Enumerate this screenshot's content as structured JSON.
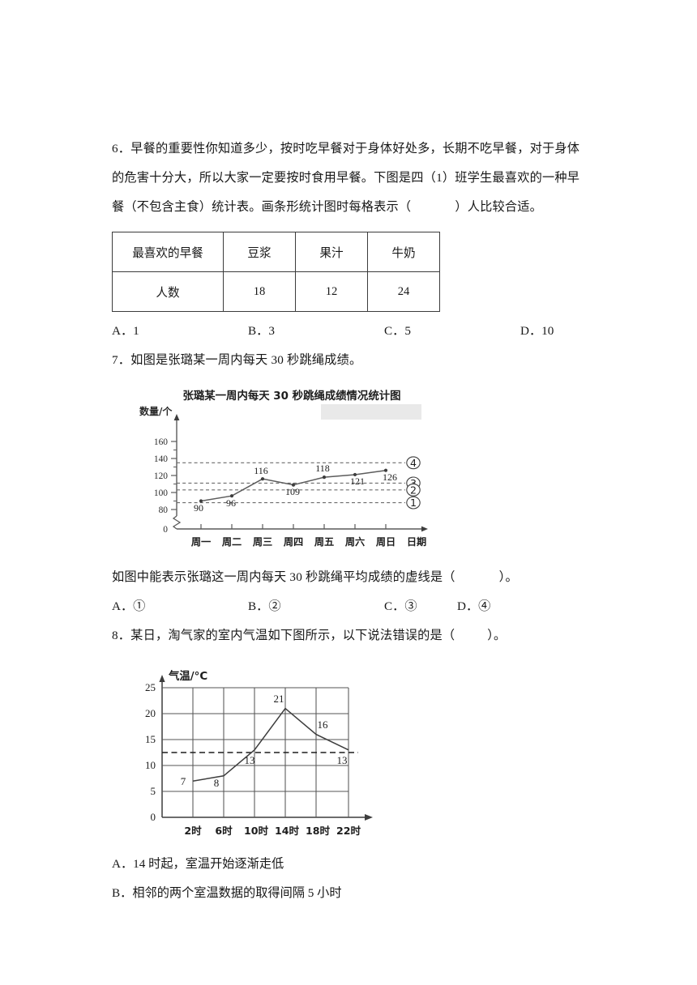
{
  "questions": [
    {
      "number": "6",
      "text_lines": [
        "6．早餐的重要性你知道多少，按时吃早餐对于身体好处多，长期不吃早餐，对于身体",
        "的危害十分大，所以大家一定要按时食用早餐。下图是四（1）班学生最喜欢的一种早",
        "餐（不包含主食）统计表。画条形统计图时每格表示（"
      ],
      "text_tail": "）人比较合适。",
      "table": {
        "header_label": "最喜欢的早餐",
        "categories": [
          "豆浆",
          "果汁",
          "牛奶"
        ],
        "row_label": "人数",
        "values": [
          "18",
          "12",
          "24"
        ]
      },
      "options": [
        "A．1",
        "B．3",
        "C．5",
        "D．10"
      ]
    },
    {
      "number": "7",
      "stem": "7．如图是张璐某一周内每天 30 秒跳绳成绩。",
      "prompt_head": "如图中能表示张璐这一周内每天 30 秒跳绳平均成绩的虚线是（",
      "prompt_tail": "）。",
      "options": [
        "A．①",
        "B．②",
        "C．③",
        "D．④"
      ]
    },
    {
      "number": "8",
      "stem_head": "8．某日，淘气家的室内气温如下图所示，以下说法错误的是（",
      "stem_tail": "）。",
      "options": [
        "A．14 时起，室温开始逐渐走低",
        "B．相邻的两个室温数据的取得间隔 5 小时"
      ]
    }
  ],
  "chart_data": [
    {
      "type": "line",
      "title": "张璐某一周内每天 30 秒跳绳成绩情况统计图",
      "xlabel": "日期",
      "ylabel": "数量/个",
      "categories": [
        "周一",
        "周二",
        "周三",
        "周四",
        "周五",
        "周六",
        "周日"
      ],
      "values": [
        90,
        96,
        116,
        109,
        118,
        121,
        126
      ],
      "yticks": [
        "80",
        "100",
        "120",
        "140",
        "160"
      ],
      "ytick_values": [
        80,
        100,
        120,
        140,
        160
      ],
      "y_origin_label": "0",
      "ylim": [
        80,
        168
      ],
      "axis_break": true,
      "grid": false,
      "legend": "none",
      "reference_lines": [
        {
          "label": "①",
          "value": 88
        },
        {
          "label": "②",
          "value": 103
        },
        {
          "label": "③",
          "value": 111
        },
        {
          "label": "④",
          "value": 135
        }
      ],
      "redaction_box": true
    },
    {
      "type": "line",
      "title": "",
      "xlabel": "",
      "ylabel": "气温/°C",
      "categories": [
        "2时",
        "6时",
        "10时",
        "14时",
        "18时",
        "22时"
      ],
      "values": [
        7,
        8,
        13,
        21,
        16,
        13
      ],
      "yticks": [
        "0",
        "5",
        "10",
        "15",
        "20",
        "25"
      ],
      "ytick_values": [
        0,
        5,
        10,
        15,
        20,
        25
      ],
      "ylim": [
        0,
        27
      ],
      "grid": true,
      "legend": "none",
      "reference_lines": [
        {
          "label": "",
          "value": 12.5
        }
      ]
    }
  ],
  "colors": {
    "page_background": "#ffffff",
    "text": "#171717",
    "table_border": "#3b3b3b",
    "chart_line": "#4a4a4a",
    "chart_axis": "#5a5a5a",
    "grid_line": "#555555",
    "dashed_line": "#6b6b6b",
    "redaction": "#e9e9e9"
  }
}
